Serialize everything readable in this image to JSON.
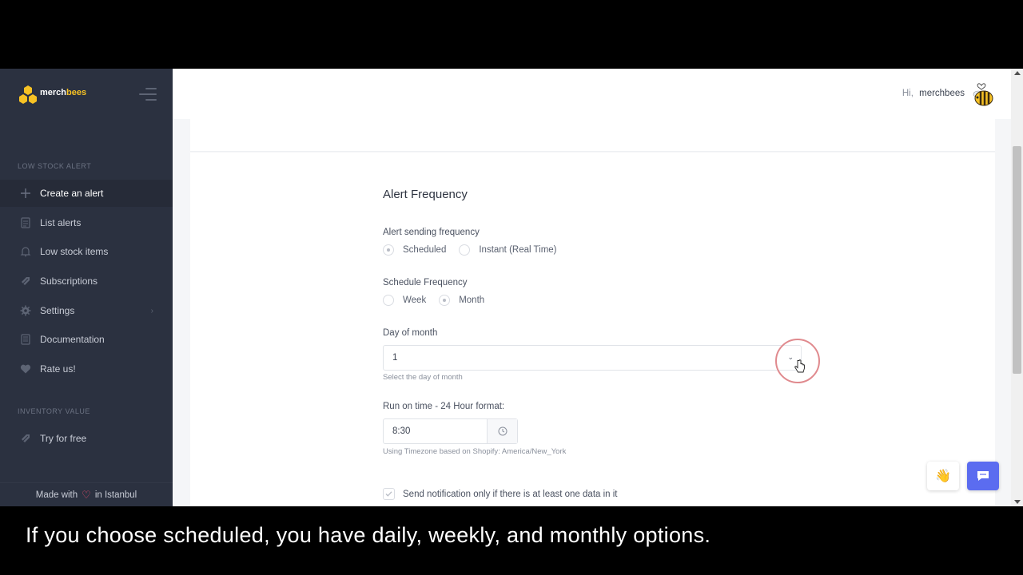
{
  "brand": {
    "name_prefix": "merch",
    "name_suffix": "bees"
  },
  "sidebar": {
    "section_low_stock": "LOW STOCK ALERT",
    "items": [
      {
        "label": "Create an alert",
        "icon": "plus-icon"
      },
      {
        "label": "List alerts",
        "icon": "list-icon"
      },
      {
        "label": "Low stock items",
        "icon": "bell-icon"
      },
      {
        "label": "Subscriptions",
        "icon": "tag-icon"
      },
      {
        "label": "Settings",
        "icon": "gear-icon"
      },
      {
        "label": "Documentation",
        "icon": "document-icon"
      },
      {
        "label": "Rate us!",
        "icon": "heart-icon"
      }
    ],
    "section_inventory": "INVENTORY VALUE",
    "inventory_items": [
      {
        "label": "Try for free",
        "icon": "tag-icon"
      }
    ],
    "footer": {
      "prefix": "Made with",
      "suffix": "in Istanbul"
    }
  },
  "header": {
    "greeting": "Hi,",
    "username": "merchbees"
  },
  "form": {
    "title": "Alert Frequency",
    "sending_frequency": {
      "label": "Alert sending frequency",
      "options": [
        "Scheduled",
        "Instant (Real Time)"
      ],
      "selected": "Scheduled"
    },
    "schedule_frequency": {
      "label": "Schedule Frequency",
      "options": [
        "Week",
        "Month"
      ],
      "selected": "Month"
    },
    "day_of_month": {
      "label": "Day of month",
      "value": "1",
      "hint": "Select the day of month"
    },
    "run_time": {
      "label": "Run on time - 24 Hour format:",
      "value": "8:30",
      "hint": "Using Timezone based on Shopify: America/New_York"
    },
    "notify_only_data": {
      "label": "Send notification only if there is at least one data in it",
      "checked": true
    }
  },
  "caption": "If you choose scheduled, you have daily, weekly, and monthly options.",
  "colors": {
    "sidebar_bg": "#2b3140",
    "accent_yellow": "#f7c224",
    "chat_button": "#5b6cf0",
    "click_ring": "#e08a8e"
  }
}
